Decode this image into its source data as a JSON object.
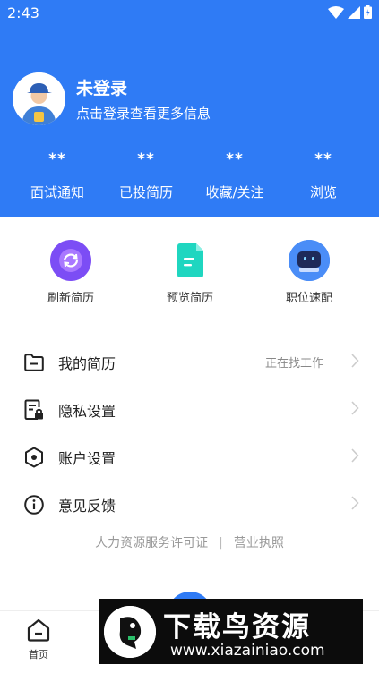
{
  "status_bar": {
    "time": "2:43"
  },
  "profile": {
    "name": "未登录",
    "subtitle": "点击登录查看更多信息"
  },
  "stats": [
    {
      "value": "**",
      "label": "面试通知"
    },
    {
      "value": "**",
      "label": "已投简历"
    },
    {
      "value": "**",
      "label": "收藏/关注"
    },
    {
      "value": "**",
      "label": "浏览"
    }
  ],
  "quick_actions": [
    {
      "label": "刷新简历",
      "icon": "refresh-icon",
      "color": "#8b5cf6"
    },
    {
      "label": "预览简历",
      "icon": "document-icon",
      "color": "#22d3c5"
    },
    {
      "label": "职位速配",
      "icon": "robot-icon",
      "color": "#3b82f6"
    }
  ],
  "menu": [
    {
      "label": "我的简历",
      "status": "正在找工作",
      "icon": "folder-icon"
    },
    {
      "label": "隐私设置",
      "status": "",
      "icon": "privacy-lock-icon"
    },
    {
      "label": "账户设置",
      "status": "",
      "icon": "hexagon-settings-icon"
    },
    {
      "label": "意见反馈",
      "status": "",
      "icon": "info-icon"
    }
  ],
  "footer_links": {
    "license": "人力资源服务许可证",
    "separator": "|",
    "business": "营业执照"
  },
  "tabbar": {
    "home_label": "首页"
  },
  "watermark": {
    "title": "下载鸟资源",
    "url": "www.xiazainiao.com"
  },
  "colors": {
    "primary": "#2f7bf5"
  }
}
